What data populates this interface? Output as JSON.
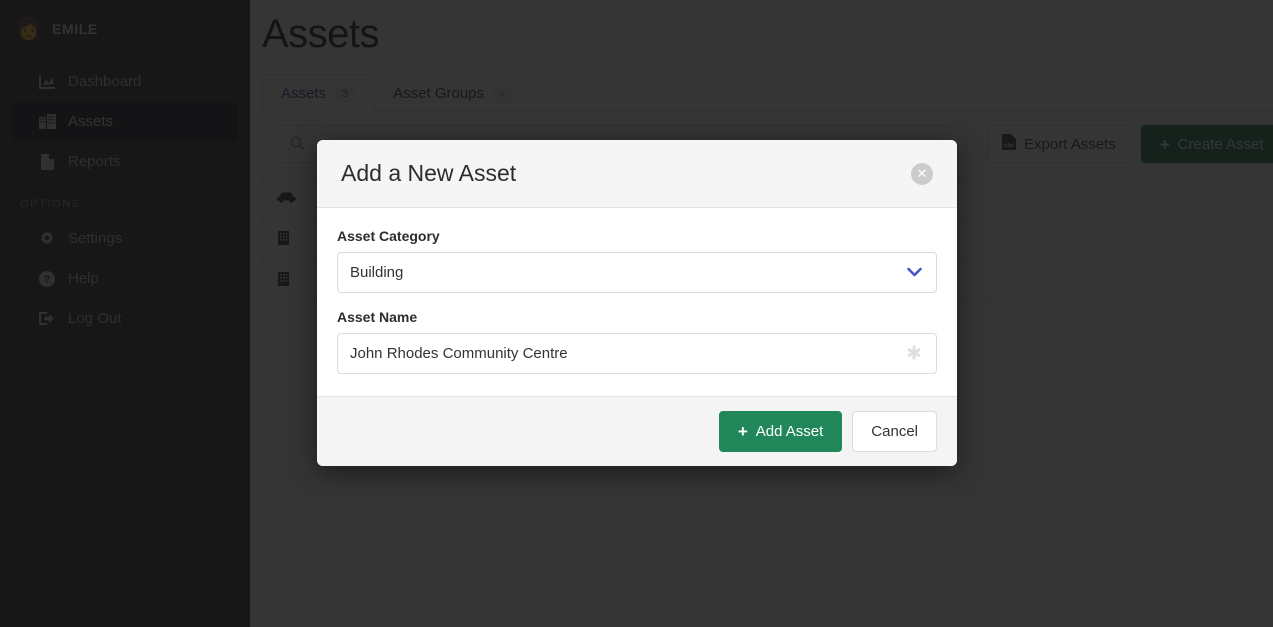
{
  "sidebar": {
    "brand": {
      "name": "EMILE",
      "avatar_icon": "user-avatar-icon"
    },
    "items": [
      {
        "label": "Dashboard",
        "icon": "chart-icon"
      },
      {
        "label": "Assets",
        "icon": "building-icon"
      },
      {
        "label": "Reports",
        "icon": "document-icon"
      }
    ],
    "options_label": "OPTIONS",
    "option_items": [
      {
        "label": "Settings",
        "icon": "gear-icon"
      },
      {
        "label": "Help",
        "icon": "question-circle-icon"
      },
      {
        "label": "Log Out",
        "icon": "logout-icon"
      }
    ]
  },
  "main": {
    "page_title": "Assets",
    "tabs": [
      {
        "label": "Assets",
        "badge": "3"
      },
      {
        "label": "Asset Groups",
        "badge": "-"
      }
    ],
    "search": {
      "value": "",
      "placeholder": "",
      "icon": "search-icon"
    },
    "export_button": {
      "label": "Export Assets",
      "icon": "csv-file-icon"
    },
    "create_button": {
      "label": "Create Asset",
      "icon": "plus-icon"
    },
    "table": {
      "header_icon": "car-icon",
      "rows": [
        {
          "icon": "building-icon"
        },
        {
          "icon": "building-icon"
        }
      ]
    }
  },
  "modal": {
    "title": "Add a New Asset",
    "close_icon": "close-icon",
    "category_field": {
      "label": "Asset Category",
      "value": "Building",
      "chevron_icon": "chevron-down-icon"
    },
    "name_field": {
      "label": "Asset Name",
      "value": "John Rhodes Community Centre",
      "placeholder": "",
      "required_icon": "asterisk-icon"
    },
    "submit_button": {
      "label": "Add Asset",
      "icon": "plus-icon"
    },
    "cancel_button": {
      "label": "Cancel"
    }
  },
  "colors": {
    "sidebar_bg": "#2b2b2b",
    "active_nav": "#161b2e",
    "primary_green": "#21875a",
    "chevron_blue": "#4556c9",
    "tab_active_text": "#2b3a8f"
  }
}
